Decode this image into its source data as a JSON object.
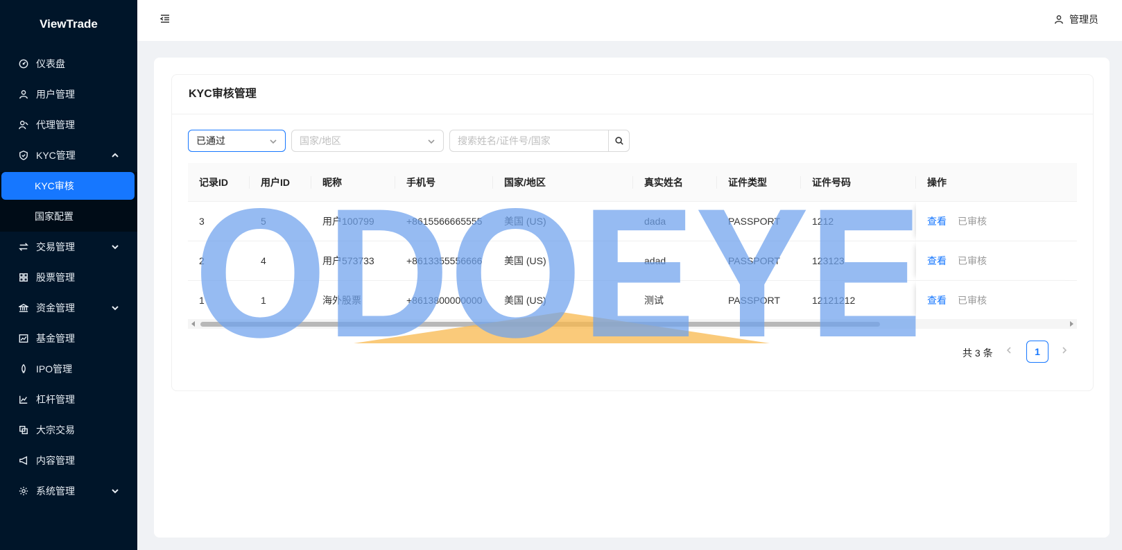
{
  "app": {
    "title": "ViewTrade"
  },
  "header": {
    "user_label": "管理员"
  },
  "sidebar": {
    "items": [
      {
        "label": "仪表盘"
      },
      {
        "label": "用户管理"
      },
      {
        "label": "代理管理"
      },
      {
        "label": "KYC管理"
      },
      {
        "label": "交易管理"
      },
      {
        "label": "股票管理"
      },
      {
        "label": "资金管理"
      },
      {
        "label": "基金管理"
      },
      {
        "label": "IPO管理"
      },
      {
        "label": "杠杆管理"
      },
      {
        "label": "大宗交易"
      },
      {
        "label": "内容管理"
      },
      {
        "label": "系统管理"
      }
    ],
    "kyc_sub": [
      {
        "label": "KYC审核"
      },
      {
        "label": "国家配置"
      }
    ]
  },
  "page": {
    "title": "KYC审核管理"
  },
  "filters": {
    "status_value": "已通过",
    "country_placeholder": "国家/地区",
    "search_placeholder": "搜索姓名/证件号/国家"
  },
  "table": {
    "columns": [
      "记录ID",
      "用户ID",
      "昵称",
      "手机号",
      "国家/地区",
      "真实姓名",
      "证件类型",
      "证件号码",
      "操作"
    ],
    "rows": [
      {
        "id": "3",
        "user_id": "5",
        "nickname": "用户100799",
        "phone": "+8615566665555",
        "country": "美国 (US)",
        "real_name": "dada",
        "doc_type": "PASSPORT",
        "doc_no": "1212",
        "action_view": "查看",
        "action_status": "已审核"
      },
      {
        "id": "2",
        "user_id": "4",
        "nickname": "用户573733",
        "phone": "+8613355556666",
        "country": "美国 (US)",
        "real_name": "adad",
        "doc_type": "PASSPORT",
        "doc_no": "123123",
        "action_view": "查看",
        "action_status": "已审核"
      },
      {
        "id": "1",
        "user_id": "1",
        "nickname": "海外股票",
        "phone": "+8613800000000",
        "country": "美国 (US)",
        "real_name": "测试",
        "doc_type": "PASSPORT",
        "doc_no": "12121212",
        "action_view": "查看",
        "action_status": "已审核"
      }
    ]
  },
  "pagination": {
    "total_text": "共 3 条",
    "current_page": "1"
  },
  "watermark": {
    "text": "ODOEYE",
    "color": "#6ea2ee"
  },
  "colors": {
    "accent": "#1677ff",
    "sidebar_bg": "#001529"
  }
}
